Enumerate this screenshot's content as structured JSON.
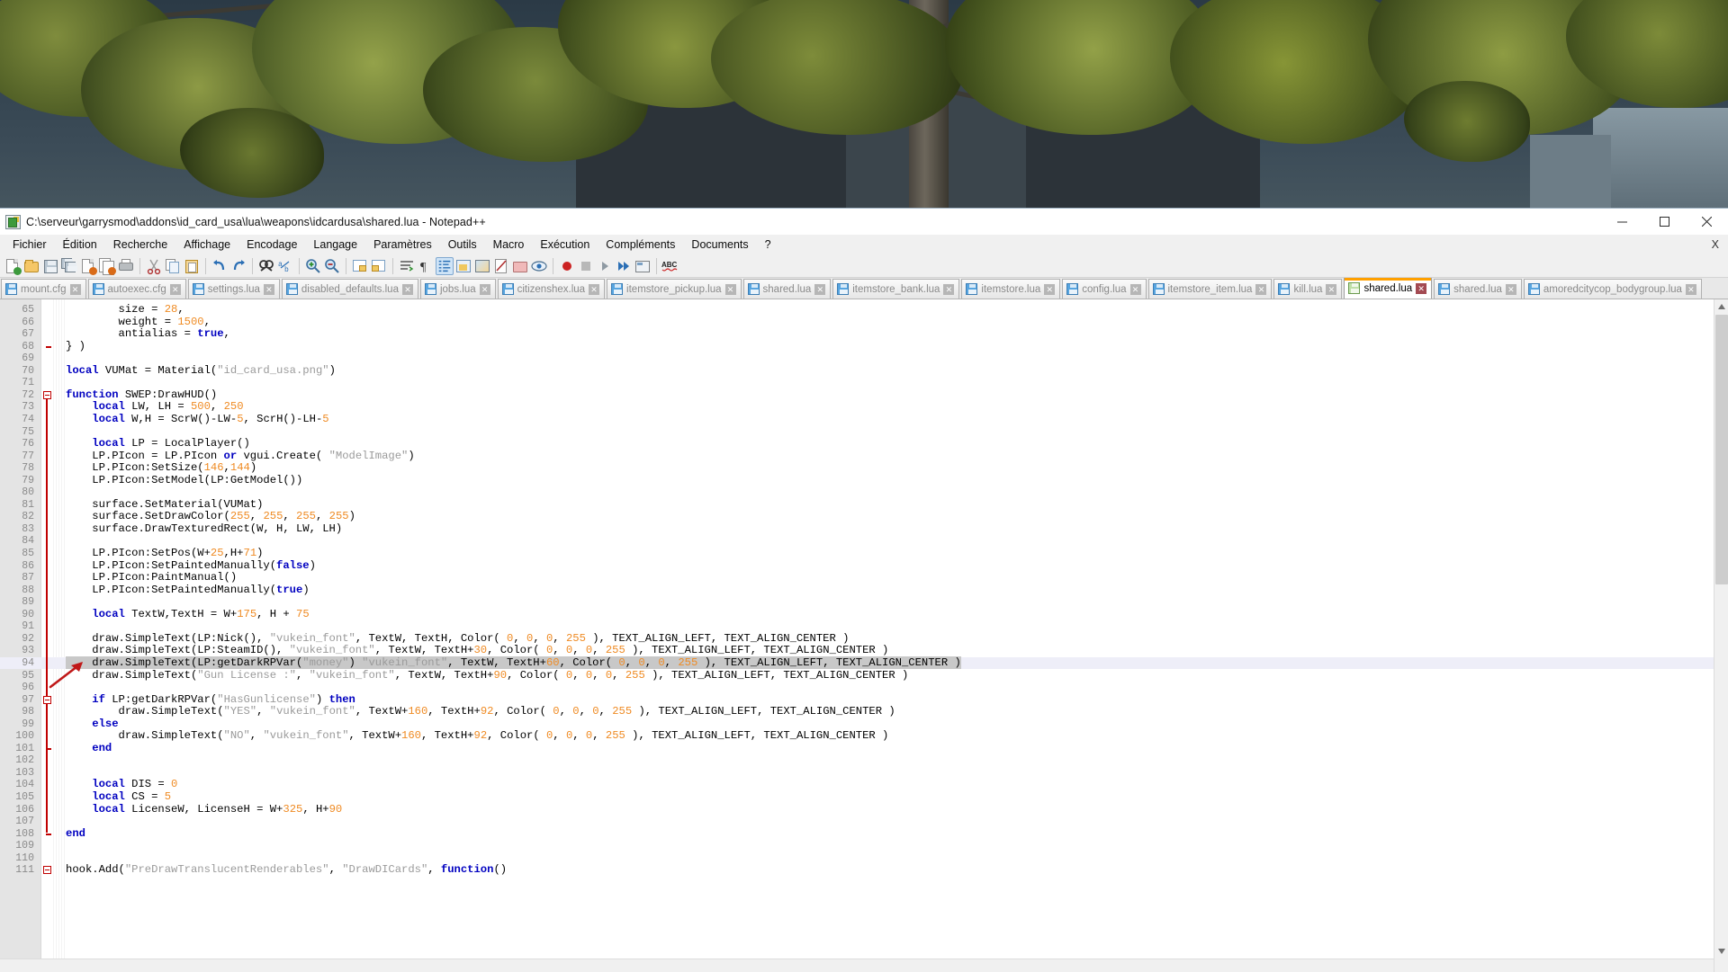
{
  "window": {
    "title": "C:\\serveur\\garrysmod\\addons\\id_card_usa\\lua\\weapons\\idcardusa\\shared.lua - Notepad++",
    "icon": "notepad-plus-plus-icon",
    "minimize_label": "─",
    "maximize_label": "❑",
    "close_label": "✕"
  },
  "menu": {
    "items": [
      {
        "label": "Fichier"
      },
      {
        "label": "Édition"
      },
      {
        "label": "Recherche"
      },
      {
        "label": "Affichage"
      },
      {
        "label": "Encodage"
      },
      {
        "label": "Langage"
      },
      {
        "label": "Paramètres"
      },
      {
        "label": "Outils"
      },
      {
        "label": "Macro"
      },
      {
        "label": "Exécution"
      },
      {
        "label": "Compléments"
      },
      {
        "label": "Documents"
      },
      {
        "label": "?"
      }
    ],
    "close_doc_label": "X"
  },
  "toolbar": {
    "icons": [
      "new-file-icon",
      "open-file-icon",
      "save-icon",
      "save-all-icon",
      "close-file-icon",
      "close-all-icon",
      "print-icon",
      "sep",
      "cut-icon",
      "copy-icon",
      "paste-icon",
      "sep",
      "undo-icon",
      "redo-icon",
      "sep",
      "find-icon",
      "replace-icon",
      "sep",
      "zoom-in-icon",
      "zoom-out-icon",
      "sep",
      "sync-vertical-icon",
      "sync-horizontal-icon",
      "sep",
      "word-wrap-icon",
      "show-all-chars-icon",
      "indent-guide-icon",
      "user-defined-dialog-icon",
      "show-symbol-icon",
      "document-map-icon",
      "function-list-icon",
      "folder-as-workspace-icon",
      "monitoring-icon",
      "sep",
      "record-macro-icon",
      "stop-macro-icon",
      "playback-macro-icon",
      "run-macro-multiple-icon",
      "save-macro-icon",
      "sep",
      "spellcheck-icon"
    ]
  },
  "tabs": {
    "items": [
      {
        "label": "mount.cfg",
        "active": false
      },
      {
        "label": "autoexec.cfg",
        "active": false
      },
      {
        "label": "settings.lua",
        "active": false
      },
      {
        "label": "disabled_defaults.lua",
        "active": false
      },
      {
        "label": "jobs.lua",
        "active": false
      },
      {
        "label": "citizenshex.lua",
        "active": false
      },
      {
        "label": "itemstore_pickup.lua",
        "active": false
      },
      {
        "label": "shared.lua",
        "active": false
      },
      {
        "label": "itemstore_bank.lua",
        "active": false
      },
      {
        "label": "itemstore.lua",
        "active": false
      },
      {
        "label": "config.lua",
        "active": false
      },
      {
        "label": "itemstore_item.lua",
        "active": false
      },
      {
        "label": "kill.lua",
        "active": false
      },
      {
        "label": "shared.lua",
        "active": true
      },
      {
        "label": "shared.lua",
        "active": false
      },
      {
        "label": "amoredcitycop_bodygroup.lua",
        "active": false
      }
    ],
    "close_glyph": "✕"
  },
  "editor": {
    "first_visible_line": 65,
    "current_line": 94,
    "selected_line_text": "draw.SimpleText(LP:getDarkRPVar(\"money\") \"vukein_font\", TextW, TextH+60, Color( 0, 0, 0, 255 ), TEXT_ALIGN_LEFT, TEXT_ALIGN_CENTER )",
    "annotation": "red-arrow-pointing-to-line-94",
    "lines": [
      {
        "n": 65,
        "t": "        size = 28,"
      },
      {
        "n": 66,
        "t": "        weight = 1500,"
      },
      {
        "n": 67,
        "t": "        antialias = true,"
      },
      {
        "n": 68,
        "t": "} )"
      },
      {
        "n": 69,
        "t": ""
      },
      {
        "n": 70,
        "t": "local VUMat = Material(\"id_card_usa.png\")"
      },
      {
        "n": 71,
        "t": ""
      },
      {
        "n": 72,
        "t": "function SWEP:DrawHUD()"
      },
      {
        "n": 73,
        "t": "    local LW, LH = 500, 250"
      },
      {
        "n": 74,
        "t": "    local W,H = ScrW()-LW-5, ScrH()-LH-5"
      },
      {
        "n": 75,
        "t": ""
      },
      {
        "n": 76,
        "t": "    local LP = LocalPlayer()"
      },
      {
        "n": 77,
        "t": "    LP.PIcon = LP.PIcon or vgui.Create( \"ModelImage\")"
      },
      {
        "n": 78,
        "t": "    LP.PIcon:SetSize(146,144)"
      },
      {
        "n": 79,
        "t": "    LP.PIcon:SetModel(LP:GetModel())"
      },
      {
        "n": 80,
        "t": ""
      },
      {
        "n": 81,
        "t": "    surface.SetMaterial(VUMat)"
      },
      {
        "n": 82,
        "t": "    surface.SetDrawColor(255, 255, 255, 255)"
      },
      {
        "n": 83,
        "t": "    surface.DrawTexturedRect(W, H, LW, LH)"
      },
      {
        "n": 84,
        "t": ""
      },
      {
        "n": 85,
        "t": "    LP.PIcon:SetPos(W+25,H+71)"
      },
      {
        "n": 86,
        "t": "    LP.PIcon:SetPaintedManually(false)"
      },
      {
        "n": 87,
        "t": "    LP.PIcon:PaintManual()"
      },
      {
        "n": 88,
        "t": "    LP.PIcon:SetPaintedManually(true)"
      },
      {
        "n": 89,
        "t": ""
      },
      {
        "n": 90,
        "t": "    local TextW,TextH = W+175, H + 75"
      },
      {
        "n": 91,
        "t": ""
      },
      {
        "n": 92,
        "t": "    draw.SimpleText(LP:Nick(), \"vukein_font\", TextW, TextH, Color( 0, 0, 0, 255 ), TEXT_ALIGN_LEFT, TEXT_ALIGN_CENTER )"
      },
      {
        "n": 93,
        "t": "    draw.SimpleText(LP:SteamID(), \"vukein_font\", TextW, TextH+30, Color( 0, 0, 0, 255 ), TEXT_ALIGN_LEFT, TEXT_ALIGN_CENTER )"
      },
      {
        "n": 94,
        "t": "    draw.SimpleText(LP:getDarkRPVar(\"money\") \"vukein_font\", TextW, TextH+60, Color( 0, 0, 0, 255 ), TEXT_ALIGN_LEFT, TEXT_ALIGN_CENTER )"
      },
      {
        "n": 95,
        "t": "    draw.SimpleText(\"Gun License :\", \"vukein_font\", TextW, TextH+90, Color( 0, 0, 0, 255 ), TEXT_ALIGN_LEFT, TEXT_ALIGN_CENTER )"
      },
      {
        "n": 96,
        "t": ""
      },
      {
        "n": 97,
        "t": "    if LP:getDarkRPVar(\"HasGunlicense\") then"
      },
      {
        "n": 98,
        "t": "        draw.SimpleText(\"YES\", \"vukein_font\", TextW+160, TextH+92, Color( 0, 0, 0, 255 ), TEXT_ALIGN_LEFT, TEXT_ALIGN_CENTER )"
      },
      {
        "n": 99,
        "t": "    else"
      },
      {
        "n": 100,
        "t": "        draw.SimpleText(\"NO\", \"vukein_font\", TextW+160, TextH+92, Color( 0, 0, 0, 255 ), TEXT_ALIGN_LEFT, TEXT_ALIGN_CENTER )"
      },
      {
        "n": 101,
        "t": "    end"
      },
      {
        "n": 102,
        "t": ""
      },
      {
        "n": 103,
        "t": ""
      },
      {
        "n": 104,
        "t": "    local DIS = 0"
      },
      {
        "n": 105,
        "t": "    local CS = 5"
      },
      {
        "n": 106,
        "t": "    local LicenseW, LicenseH = W+325, H+90"
      },
      {
        "n": 107,
        "t": ""
      },
      {
        "n": 108,
        "t": "end"
      },
      {
        "n": 109,
        "t": ""
      },
      {
        "n": 110,
        "t": ""
      },
      {
        "n": 111,
        "t": "hook.Add(\"PreDrawTranslucentRenderables\", \"DrawDICards\", function()"
      }
    ]
  },
  "colors": {
    "keyword": "#0000c0",
    "number": "#ef8b24",
    "string": "#9a9a9a",
    "paren_highlight": "#c00000",
    "active_tab_bar": "#ffa000",
    "current_line_bg": "#eeeef8",
    "selection_bg": "#c8c8c8",
    "gutter_bg": "#e4e4e4"
  }
}
